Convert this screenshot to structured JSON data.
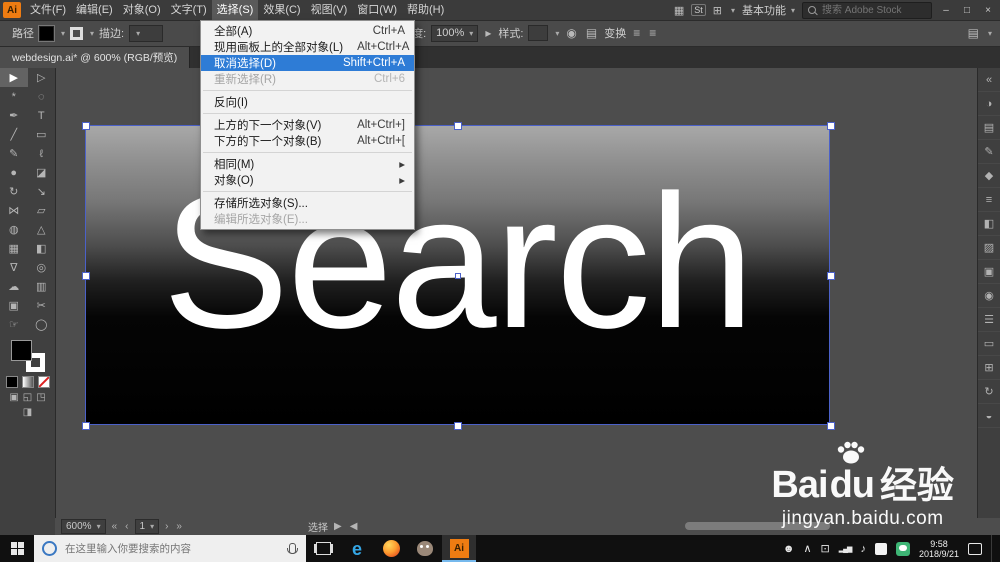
{
  "colors": {
    "selection_outline": "#4b61c9",
    "menu_highlight": "#2e7cd6",
    "ai_orange": "#ee7c12",
    "taskbar_green": "#3eb575"
  },
  "menubar": {
    "logo": "Ai",
    "menus": [
      {
        "label": "文件(F)"
      },
      {
        "label": "编辑(E)"
      },
      {
        "label": "对象(O)"
      },
      {
        "label": "文字(T)"
      },
      {
        "label": "选择(S)"
      },
      {
        "label": "效果(C)"
      },
      {
        "label": "视图(V)"
      },
      {
        "label": "窗口(W)"
      },
      {
        "label": "帮助(H)"
      }
    ],
    "stock_badge": "St",
    "workspace": "基本功能",
    "stock_search_placeholder": "搜索 Adobe Stock"
  },
  "controlbar": {
    "target_label": "路径",
    "stroke_label": "描边:",
    "opacity_label": "不透明度:",
    "opacity_value": "100%",
    "style_label": "样式:",
    "transform_label": "变换"
  },
  "tabbar": {
    "title": "webdesign.ai* @ 600% (RGB/预览)"
  },
  "select_menu": {
    "items": [
      {
        "label": "全部(A)",
        "shortcut": "Ctrl+A"
      },
      {
        "label": "现用画板上的全部对象(L)",
        "shortcut": "Alt+Ctrl+A"
      },
      {
        "label": "取消选择(D)",
        "shortcut": "Shift+Ctrl+A",
        "state": "highlighted"
      },
      {
        "label": "重新选择(R)",
        "shortcut": "Ctrl+6",
        "state": "disabled"
      },
      {
        "label": "反向(I)"
      },
      {
        "label": "上方的下一个对象(V)",
        "shortcut": "Alt+Ctrl+]"
      },
      {
        "label": "下方的下一个对象(B)",
        "shortcut": "Alt+Ctrl+["
      },
      {
        "label": "相同(M)",
        "submenu": true
      },
      {
        "label": "对象(O)",
        "submenu": true
      },
      {
        "label": "存储所选对象(S)..."
      },
      {
        "label": "编辑所选对象(E)...",
        "state": "disabled"
      }
    ]
  },
  "tools": [
    {
      "name": "selection-tool",
      "glyph": "▶"
    },
    {
      "name": "direct-selection-tool",
      "glyph": "▷"
    },
    {
      "name": "magic-wand-tool",
      "glyph": "*"
    },
    {
      "name": "lasso-tool",
      "glyph": "◌"
    },
    {
      "name": "pen-tool",
      "glyph": "✒"
    },
    {
      "name": "type-tool",
      "glyph": "T"
    },
    {
      "name": "line-segment-tool",
      "glyph": "╱"
    },
    {
      "name": "rectangle-tool",
      "glyph": "▭"
    },
    {
      "name": "paintbrush-tool",
      "glyph": "✎"
    },
    {
      "name": "pencil-tool",
      "glyph": "ℓ"
    },
    {
      "name": "blob-brush-tool",
      "glyph": "●"
    },
    {
      "name": "eraser-tool",
      "glyph": "◪"
    },
    {
      "name": "rotate-tool",
      "glyph": "↻"
    },
    {
      "name": "scale-tool",
      "glyph": "↘"
    },
    {
      "name": "width-tool",
      "glyph": "⋈"
    },
    {
      "name": "free-transform-tool",
      "glyph": "▱"
    },
    {
      "name": "shape-builder-tool",
      "glyph": "◍"
    },
    {
      "name": "perspective-grid-tool",
      "glyph": "△"
    },
    {
      "name": "mesh-tool",
      "glyph": "▦"
    },
    {
      "name": "gradient-tool",
      "glyph": "◧"
    },
    {
      "name": "eyedropper-tool",
      "glyph": "∇"
    },
    {
      "name": "blend-tool",
      "glyph": "◎"
    },
    {
      "name": "symbol-sprayer-tool",
      "glyph": "☁"
    },
    {
      "name": "graph-tool",
      "glyph": "▥"
    },
    {
      "name": "artboard-tool",
      "glyph": "▣"
    },
    {
      "name": "slice-tool",
      "glyph": "✂"
    },
    {
      "name": "hand-tool",
      "glyph": "☞"
    },
    {
      "name": "zoom-tool",
      "glyph": "◯"
    }
  ],
  "dock": [
    {
      "name": "collapse-dock-icon",
      "glyph": "«"
    },
    {
      "name": "color-panel-icon",
      "glyph": "◑"
    },
    {
      "name": "swatches-panel-icon",
      "glyph": "▤"
    },
    {
      "name": "brushes-panel-icon",
      "glyph": "✎"
    },
    {
      "name": "symbols-panel-icon",
      "glyph": "◆"
    },
    {
      "name": "stroke-panel-icon",
      "glyph": "≡"
    },
    {
      "name": "gradient-panel-icon",
      "glyph": "◧"
    },
    {
      "name": "transparency-panel-icon",
      "glyph": "▨"
    },
    {
      "name": "graphic-styles-panel-icon",
      "glyph": "▣"
    },
    {
      "name": "appearance-panel-icon",
      "glyph": "◉"
    },
    {
      "name": "layers-panel-icon",
      "glyph": "☰"
    },
    {
      "name": "artboards-panel-icon",
      "glyph": "▭"
    },
    {
      "name": "align-panel-icon",
      "glyph": "⊞"
    },
    {
      "name": "transform-panel-icon",
      "glyph": "↻"
    },
    {
      "name": "info-panel-icon",
      "glyph": "◒"
    }
  ],
  "canvas": {
    "artwork_text": "Search"
  },
  "statusbar": {
    "zoom": "600%",
    "artboard_number": "1",
    "tool_status": "选择"
  },
  "watermark": {
    "brand_prefix": "Bai",
    "brand_suffix": "du",
    "brand_cn": "经验",
    "url": "jingyan.baidu.com"
  },
  "taskbar": {
    "search_placeholder": "在这里输入你要搜索的内容",
    "ai_label": "Ai",
    "time": "9:58",
    "date": "2018/9/21"
  },
  "icons": {
    "chevron_down": "▾",
    "submenu_arrow": "▸",
    "window_min": "–",
    "window_max": "□",
    "window_close": "×",
    "apps_grid": "▦",
    "layout": "⊞",
    "globe": "◉",
    "columns": "▤",
    "panel_menu": "≡",
    "nav_first": "«",
    "nav_prev": "‹",
    "nav_next": "›",
    "nav_last": "»",
    "divider_right": "▶",
    "divider_left": "◀",
    "person": "☻",
    "chevron_up": "∧",
    "pc": "⊡",
    "signal": "▂▄▆",
    "speaker": "♪",
    "draw_normal": "▣",
    "draw_behind": "◱",
    "draw_inside": "◳",
    "screen_mode": "◨",
    "edge": "e"
  }
}
